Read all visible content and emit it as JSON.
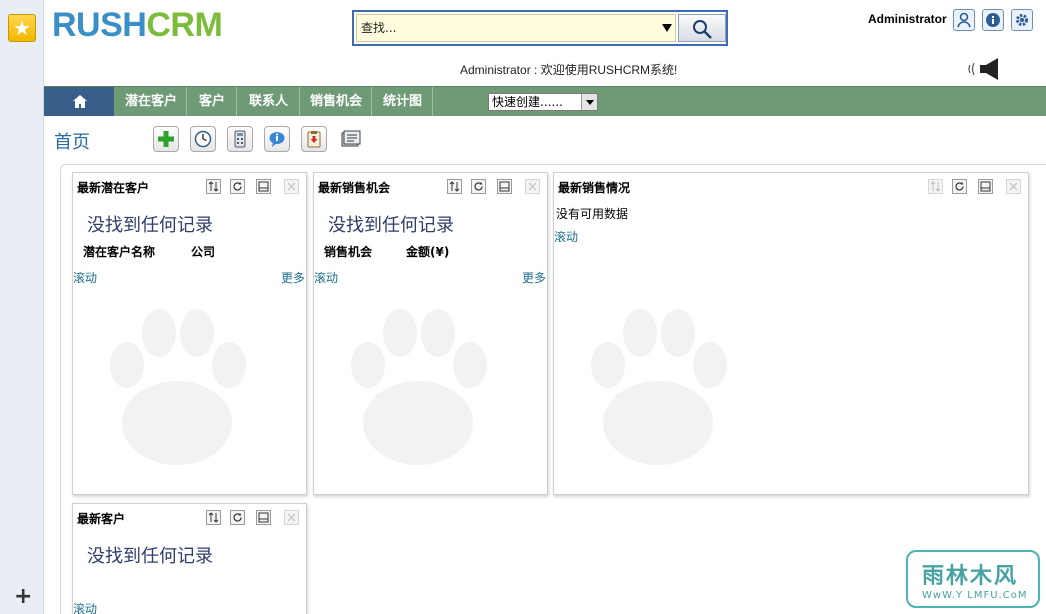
{
  "app": {
    "logo_part1": "RUSH",
    "logo_part2": "CRM"
  },
  "search": {
    "placeholder": "查找..."
  },
  "header": {
    "user": "Administrator",
    "welcome": "Administrator : 欢迎使用RUSHCRM系统!"
  },
  "nav": {
    "items": [
      "潜在客户",
      "客户",
      "联系人",
      "销售机会",
      "统计图"
    ],
    "quick_create": "快速创建......"
  },
  "page": {
    "title": "首页"
  },
  "widgets": [
    {
      "title": "最新潜在客户",
      "empty": "没找到任何记录",
      "col1": "潜在客户名称",
      "col2": "公司",
      "scroll": "滚动",
      "more": "更多"
    },
    {
      "title": "最新销售机会",
      "empty": "没找到任何记录",
      "col1": "销售机会",
      "col2": "金额(¥)",
      "scroll": "滚动",
      "more": "更多"
    },
    {
      "title": "最新销售情况",
      "nodata": "没有可用数据",
      "scroll": "滚动"
    },
    {
      "title": "最新客户",
      "empty": "没找到任何记录",
      "scroll": "滚动"
    }
  ],
  "watermark": {
    "line1": "雨林木风",
    "line2": "WwW.Y LMFU.CoM"
  },
  "colors": {
    "nav_bg": "#6e9a76",
    "home_bg": "#3a5e8a",
    "logo_blue": "#3a8fc6",
    "logo_green": "#7cbc3a"
  }
}
